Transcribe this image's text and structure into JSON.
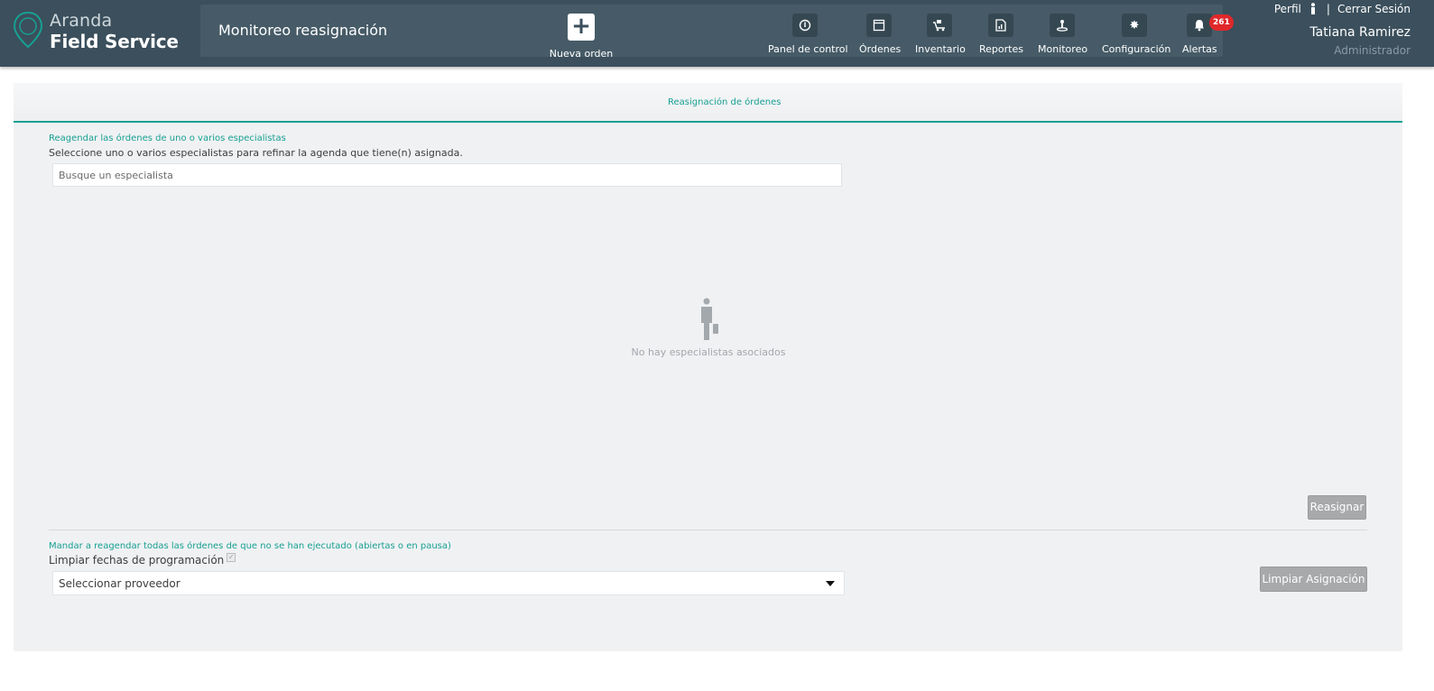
{
  "brand": {
    "line1": "Aranda",
    "line2": "Field Service"
  },
  "header": {
    "page_title": "Monitoreo reasignación",
    "new_order_label": "Nueva orden",
    "nav": [
      {
        "label": "Panel de control",
        "icon": "dashboard-icon"
      },
      {
        "label": "Órdenes",
        "icon": "orders-icon"
      },
      {
        "label": "Inventario",
        "icon": "inventory-icon"
      },
      {
        "label": "Reportes",
        "icon": "reports-icon"
      },
      {
        "label": "Monitoreo",
        "icon": "monitoring-icon"
      },
      {
        "label": "Configuración",
        "icon": "settings-icon"
      },
      {
        "label": "Alertas",
        "icon": "bell-icon"
      }
    ],
    "alerts_count": "261",
    "profile_label": "Perfil",
    "logout_label": "Cerrar Sesión",
    "user_name": "Tatiana Ramirez",
    "user_role": "Administrador"
  },
  "tabs": {
    "active": "Reasignación de órdenes"
  },
  "section1": {
    "title": "Reagendar las órdenes de uno o varios especialistas",
    "description": "Seleccione uno o varios especialistas para refinar la agenda que tiene(n) asignada.",
    "search_placeholder": "Busque un especialista",
    "empty_text": "No hay especialistas asociados",
    "reassign_button": "Reasignar"
  },
  "section2": {
    "title": "Mandar a reagendar todas las órdenes de que no se han ejecutado (abiertas o en pausa)",
    "clear_dates_label": "Limpiar fechas de programación",
    "clear_dates_checked": true,
    "provider_value": "Seleccionar proveedor",
    "clear_assignment_button": "Limpiar Asignación"
  },
  "colors": {
    "header_bg": "#3b4f5c",
    "accent": "#17a092",
    "badge": "#e0282b"
  }
}
